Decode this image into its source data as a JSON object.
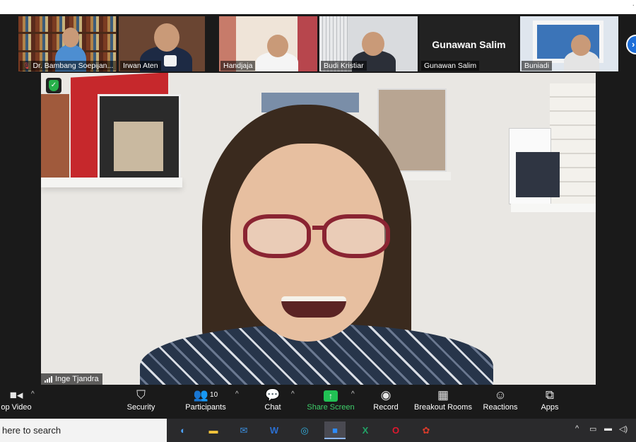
{
  "thumbnails": [
    {
      "name": "Dr. Bambang Soepijan...",
      "muted": true
    },
    {
      "name": "Irwan Aten",
      "muted": false
    },
    {
      "name": "Handjaja",
      "muted": false
    },
    {
      "name": "Budi Kristiar",
      "muted": false
    },
    {
      "name": "Gunawan Salim",
      "muted": false,
      "video_off_label": "Gunawan Salim"
    },
    {
      "name": "Buniadi",
      "muted": false
    }
  ],
  "main_video": {
    "speaker_name": "Inge Tjandra"
  },
  "toolbar": {
    "stop_video": "op Video",
    "security": "Security",
    "participants": "Participants",
    "participants_count": "10",
    "chat": "Chat",
    "share_screen": "Share Screen",
    "record": "Record",
    "breakout_rooms": "Breakout Rooms",
    "reactions": "Reactions",
    "apps": "Apps"
  },
  "taskbar": {
    "search_placeholder": "here to search",
    "apps": [
      "edge-legacy-icon",
      "file-explorer-icon",
      "mail-icon",
      "word-icon",
      "edge-icon",
      "zoom-icon",
      "excel-icon",
      "opera-icon",
      "media-app-icon"
    ]
  },
  "colors": {
    "accent_green": "#21c154",
    "zoom_blue": "#1e6fd9",
    "bg": "#1a1a1a"
  }
}
